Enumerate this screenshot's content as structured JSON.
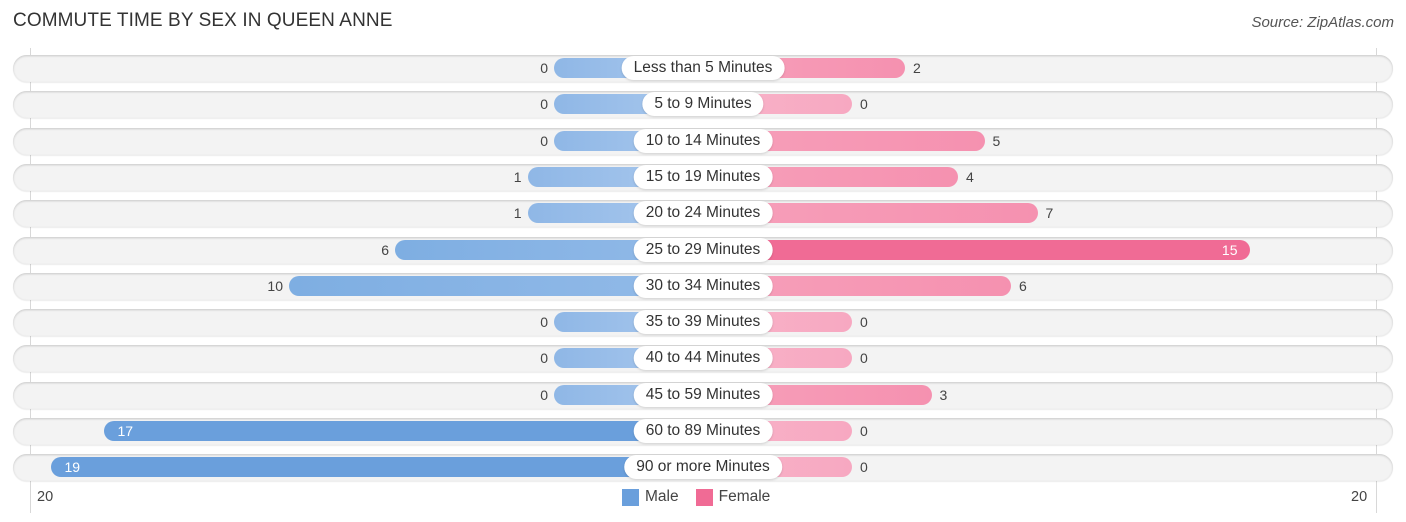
{
  "title": "COMMUTE TIME BY SEX IN QUEEN ANNE",
  "source": "Source: ZipAtlas.com",
  "colors": {
    "male": "#6a9fdc",
    "male_light": "#a9c8ee",
    "female": "#f06b95",
    "female_light": "#f7a8c1"
  },
  "chart_data": {
    "type": "bar",
    "orientation": "horizontal-diverging",
    "title": "COMMUTE TIME BY SEX IN QUEEN ANNE",
    "categories": [
      "Less than 5 Minutes",
      "5 to 9 Minutes",
      "10 to 14 Minutes",
      "15 to 19 Minutes",
      "20 to 24 Minutes",
      "25 to 29 Minutes",
      "30 to 34 Minutes",
      "35 to 39 Minutes",
      "40 to 44 Minutes",
      "45 to 59 Minutes",
      "60 to 89 Minutes",
      "90 or more Minutes"
    ],
    "series": [
      {
        "name": "Male",
        "values": [
          0,
          0,
          0,
          1,
          1,
          6,
          10,
          0,
          0,
          0,
          17,
          19
        ]
      },
      {
        "name": "Female",
        "values": [
          2,
          0,
          5,
          4,
          7,
          15,
          6,
          0,
          0,
          3,
          0,
          0
        ]
      }
    ],
    "axis": {
      "left_tick": "20",
      "right_tick": "20",
      "max": 20
    },
    "legend": {
      "position": "bottom-center",
      "entries": [
        "Male",
        "Female"
      ]
    }
  }
}
